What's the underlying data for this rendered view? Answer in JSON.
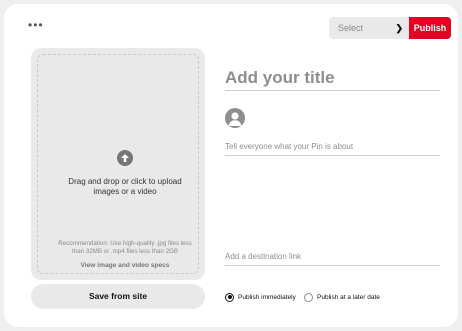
{
  "toolbar": {
    "more_label": "•••",
    "board_select_value": "Select",
    "publish_label": "Publish"
  },
  "upload": {
    "drag_text": "Drag and drop or click to upload images or a video",
    "recommendation": "Recommendation: Use high-quality .jpg files less than 32MB or .mp4 files less than 2GB",
    "specs_link": "View image and video specs",
    "save_from_site_label": "Save from site"
  },
  "form": {
    "title_placeholder": "Add your title",
    "description_placeholder": "Tell everyone what your Pin is about",
    "link_placeholder": "Add a destination link"
  },
  "publish_options": {
    "immediately_label": "Publish immediately",
    "later_label": "Publish at a later date",
    "selected": "immediately"
  },
  "colors": {
    "accent": "#e60023",
    "panel": "#e9e9e9",
    "background": "#efefef"
  }
}
